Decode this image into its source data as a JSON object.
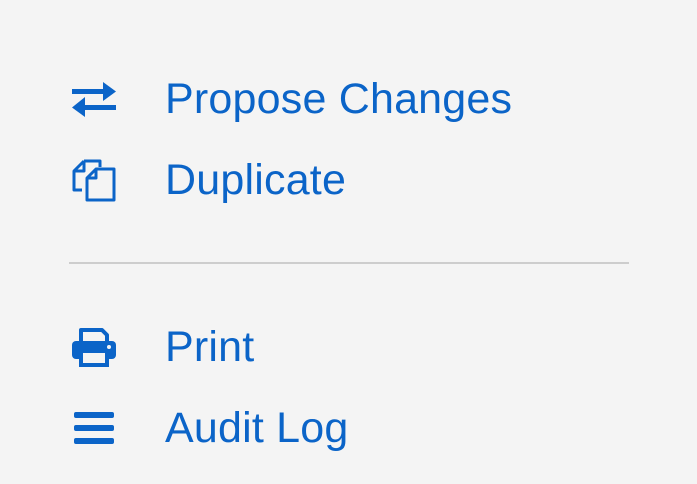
{
  "menu": {
    "groups": [
      {
        "items": [
          {
            "label": "Propose Changes",
            "icon": "swap-arrows-icon"
          },
          {
            "label": "Duplicate",
            "icon": "duplicate-icon"
          }
        ]
      },
      {
        "items": [
          {
            "label": "Print",
            "icon": "printer-icon"
          },
          {
            "label": "Audit Log",
            "icon": "list-icon"
          }
        ]
      }
    ]
  },
  "colors": {
    "background": "#f4f4f4",
    "accent": "#0b64c8",
    "divider": "#cdcdcd"
  }
}
